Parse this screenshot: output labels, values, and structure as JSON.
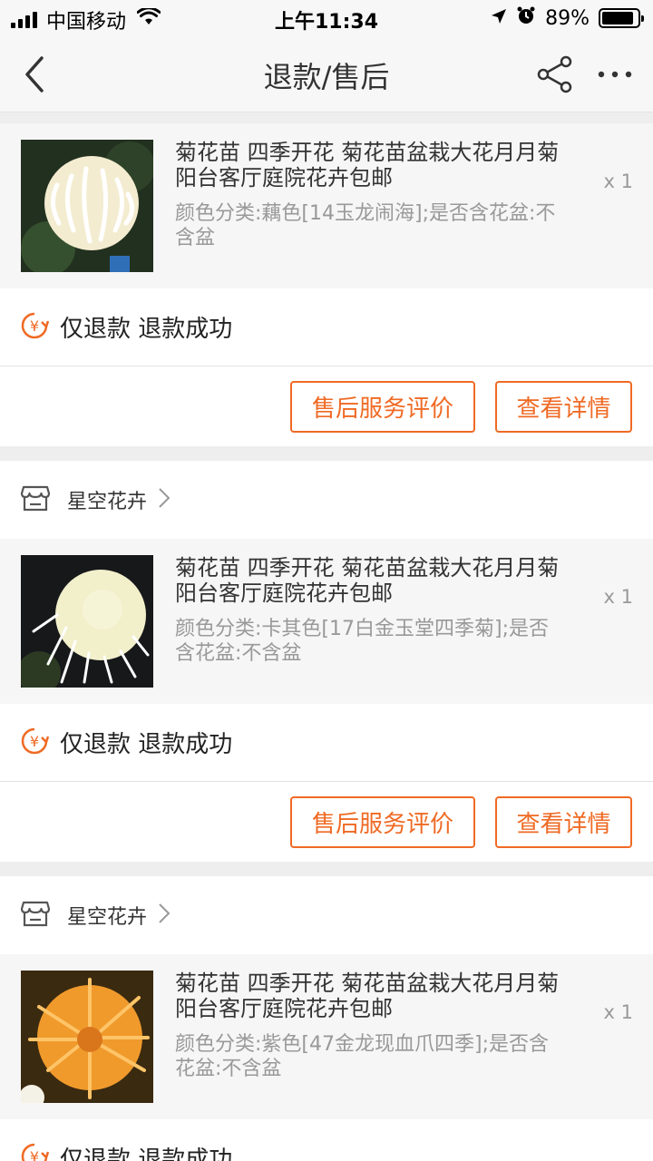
{
  "status_bar": {
    "carrier": "中国移动",
    "time": "上午11:34",
    "battery": "89%",
    "battery_level": 0.89
  },
  "nav": {
    "title": "退款/售后",
    "back_icon": "chevron-left-icon",
    "share_icon": "share-icon",
    "more_icon": "more-icon"
  },
  "orders": [
    {
      "shop": "",
      "title": "菊花苗 四季开花 菊花苗盆栽大花月月菊阳台客厅庭院花卉包邮",
      "sku": "颜色分类:藕色[14玉龙闹海];是否含花盆:不含盆",
      "qty": "x 1",
      "refund_type": "仅退款",
      "refund_status": "退款成功",
      "review_label": "售后服务评价",
      "detail_label": "查看详情",
      "flower_color": "#f3ecd0"
    },
    {
      "shop": "星空花卉",
      "title": "菊花苗 四季开花 菊花苗盆栽大花月月菊阳台客厅庭院花卉包邮",
      "sku": "颜色分类:卡其色[17白金玉堂四季菊];是否含花盆:不含盆",
      "qty": "x 1",
      "refund_type": "仅退款",
      "refund_status": "退款成功",
      "review_label": "售后服务评价",
      "detail_label": "查看详情",
      "flower_color": "#f2efcb"
    },
    {
      "shop": "星空花卉",
      "title": "菊花苗 四季开花 菊花苗盆栽大花月月菊阳台客厅庭院花卉包邮",
      "sku": "颜色分类:紫色[47金龙现血爪四季];是否含花盆:不含盆",
      "qty": "x 1",
      "refund_type": "仅退款",
      "refund_status": "退款成功",
      "flower_color": "#f09a2c"
    }
  ],
  "colors": {
    "accent": "#ef6a24",
    "muted": "#999999"
  }
}
